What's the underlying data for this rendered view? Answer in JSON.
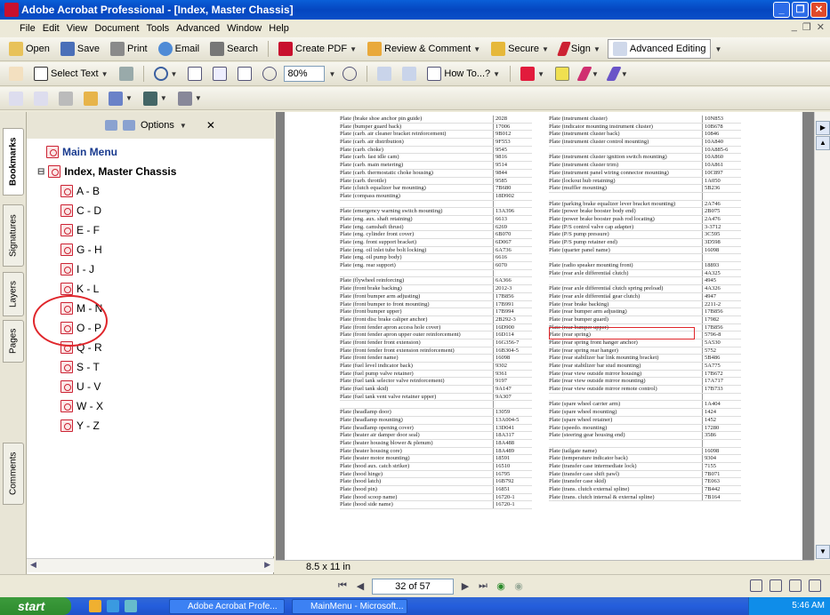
{
  "window": {
    "title": "Adobe Acrobat Professional - [Index, Master Chassis]",
    "controls": [
      "_",
      "❐",
      "✕"
    ]
  },
  "menu": [
    "File",
    "Edit",
    "View",
    "Document",
    "Tools",
    "Advanced",
    "Window",
    "Help"
  ],
  "mdi_controls": [
    "_",
    "❐",
    "✕"
  ],
  "toolbar1": {
    "open": "Open",
    "save": "Save",
    "print": "Print",
    "email": "Email",
    "search": "Search",
    "create_pdf": "Create PDF",
    "review": "Review & Comment",
    "secure": "Secure",
    "sign": "Sign",
    "advanced_editing": "Advanced Editing"
  },
  "toolbar2": {
    "select_text": "Select Text",
    "zoom": "80%",
    "howto": "How To...?"
  },
  "panel": {
    "options": "Options",
    "close": "✕",
    "tabs": [
      "Bookmarks",
      "Signatures",
      "Layers",
      "Pages",
      "Comments"
    ],
    "bookmarks": [
      "Main Menu",
      "Index, Master Chassis",
      "A - B",
      "C - D",
      "E - F",
      "G - H",
      "I - J",
      "K - L",
      "M - N",
      "O - P",
      "Q - R",
      "S - T",
      "U - V",
      "W - X",
      "Y - Z"
    ]
  },
  "document": {
    "left_column": [
      [
        "Plate (brake shoe anchor pin guide)",
        "2028"
      ],
      [
        "Plate (bumper guard back)",
        "17006"
      ],
      [
        "Plate (carb. air cleaner bracket reinforcement)",
        "9B012"
      ],
      [
        "Plate (carb. air distribution)",
        "9F553"
      ],
      [
        "Plate (carb. choke)",
        "9545"
      ],
      [
        "Plate (carb. fast idle cam)",
        "9816"
      ],
      [
        "Plate (carb. main metering)",
        "9514"
      ],
      [
        "Plate (carb. thermostatic choke housing)",
        "9844"
      ],
      [
        "Plate (carb. throttle)",
        "9585"
      ],
      [
        "Plate (clutch equalizer bar mounting)",
        "7B680"
      ],
      [
        "Plate (compass mounting)",
        "18D902"
      ],
      [
        "",
        ""
      ],
      [
        "Plate (emergency warning switch mounting)",
        "13A396"
      ],
      [
        "Plate (eng. aux. shaft retaining)",
        "6613"
      ],
      [
        "Plate (eng. camshaft thrust)",
        "6269"
      ],
      [
        "Plate (eng. cylinder front cover)",
        "6B070"
      ],
      [
        "Plate (eng. front support bracket)",
        "6D067"
      ],
      [
        "Plate (eng. oil inlet tube bolt locking)",
        "6A736"
      ],
      [
        "Plate (eng. oil pump body)",
        "6616"
      ],
      [
        "Plate (eng. rear support)",
        "6070"
      ],
      [
        "",
        ""
      ],
      [
        "Plate (flywheel reinforcing)",
        "6A366"
      ],
      [
        "Plate (front brake backing)",
        "2012-3"
      ],
      [
        "Plate (front bumper arm adjusting)",
        "17B856"
      ],
      [
        "Plate (front bumper to front mounting)",
        "17B991"
      ],
      [
        "Plate (front bumper upper)",
        "17B994"
      ],
      [
        "Plate (front disc brake caliper anchor)",
        "2B292-3"
      ],
      [
        "Plate (front fender apron access hole cover)",
        "16D900"
      ],
      [
        "Plate (front fender apron upper outer reinforcement)",
        "16D114"
      ],
      [
        "Plate (front fender front extension)",
        "16G356-7"
      ],
      [
        "Plate (front fender front extension reinforcement)",
        "16B304-5"
      ],
      [
        "Plate (front fender name)",
        "16098"
      ],
      [
        "Plate (fuel level indicator back)",
        "9302"
      ],
      [
        "Plate (fuel pump valve retainer)",
        "9361"
      ],
      [
        "Plate (fuel tank selector valve reinforcement)",
        "9197"
      ],
      [
        "Plate (fuel tank skid)",
        "9A147"
      ],
      [
        "Plate (fuel tank vent valve retainer upper)",
        "9A307"
      ],
      [
        "",
        ""
      ],
      [
        "Plate (headlamp door)",
        "13059"
      ],
      [
        "Plate (headlamp mounting)",
        "13A004-5"
      ],
      [
        "Plate (headlamp opening cover)",
        "13D041"
      ],
      [
        "Plate (heater air damper door seal)",
        "18A317"
      ],
      [
        "Plate (heater housing blower & plenum)",
        "18A488"
      ],
      [
        "Plate (heater housing core)",
        "18A489"
      ],
      [
        "Plate (heater motor mounting)",
        "18591"
      ],
      [
        "Plate (hood aux. catch striker)",
        "16510"
      ],
      [
        "Plate (hood hinge)",
        "16795"
      ],
      [
        "Plate (hood latch)",
        "16B792"
      ],
      [
        "Plate (hood pin)",
        "16851"
      ],
      [
        "Plate (hood scoop name)",
        "16720-1"
      ],
      [
        "Plate (hood side name)",
        "16720-1"
      ]
    ],
    "right_column": [
      [
        "Plate (instrument cluster)",
        "10N853"
      ],
      [
        "Plate (indicator mounting instrument cluster)",
        "10B678"
      ],
      [
        "Plate (instrument cluster back)",
        "10846"
      ],
      [
        "Plate (instrument cluster control mounting)",
        "10A840"
      ],
      [
        "",
        "10A885-6"
      ],
      [
        "Plate (instrument cluster ignition switch mounting)",
        "10A860"
      ],
      [
        "Plate (instrument cluster trim)",
        "10A861"
      ],
      [
        "Plate (instrument panel wiring connector mounting)",
        "10C897"
      ],
      [
        "Plate (lockout hub retaining)",
        "1A050"
      ],
      [
        "Plate (muffler mounting)",
        "5B236"
      ],
      [
        "",
        ""
      ],
      [
        "Plate (parking brake equalizer lever bracket mounting)",
        "2A746"
      ],
      [
        "Plate (power brake booster body end)",
        "2B075"
      ],
      [
        "Plate (power brake booster push rod locating)",
        "2A476"
      ],
      [
        "Plate (P/S control valve cap adapter)",
        "3-3712"
      ],
      [
        "Plate (P/S pump pressure)",
        "3C595"
      ],
      [
        "Plate (P/S pump retainer end)",
        "3D598"
      ],
      [
        "Plate (quarter panel name)",
        "16098"
      ],
      [
        "",
        ""
      ],
      [
        "Plate (radio speaker mounting front)",
        "18893"
      ],
      [
        "Plate (rear axle differential clutch)",
        "4A325"
      ],
      [
        "",
        "4945"
      ],
      [
        "Plate (rear axle differential clutch spring preload)",
        "4A326"
      ],
      [
        "Plate (rear axle differential gear clutch)",
        "4947"
      ],
      [
        "Plate (rear brake backing)",
        "2211-2"
      ],
      [
        "Plate (rear bumper arm adjusting)",
        "17B856"
      ],
      [
        "Plate (rear bumper guard)",
        "17982"
      ],
      [
        "Plate (rear bumper upper)",
        "17B856"
      ],
      [
        "Plate (rear spring)",
        "5796-8"
      ],
      [
        "Plate (rear spring front hanger anchor)",
        "5A530"
      ],
      [
        "Plate (rear spring rear hanger)",
        "5752"
      ],
      [
        "Plate (rear stabilizer bar link mounting bracket)",
        "5B486"
      ],
      [
        "Plate (rear stabilizer bar stud mounting)",
        "5A775"
      ],
      [
        "Plate (rear view outside mirror housing)",
        "17B672"
      ],
      [
        "Plate (rear view outside mirror mounting)",
        "17A717"
      ],
      [
        "Plate (rear view outside mirror remote control)",
        "17B733"
      ],
      [
        "",
        ""
      ],
      [
        "Plate (spare wheel carrier arm)",
        "1A404"
      ],
      [
        "Plate (spare wheel mounting)",
        "1424"
      ],
      [
        "Plate (spare wheel retainer)",
        "1452"
      ],
      [
        "Plate (speedo. mounting)",
        "17280"
      ],
      [
        "Plate (steering gear housing end)",
        "3586"
      ],
      [
        "",
        ""
      ],
      [
        "Plate (tailgate name)",
        "16098"
      ],
      [
        "Plate (temperature indicator back)",
        "9304"
      ],
      [
        "Plate (transfer case intermediate lock)",
        "7155"
      ],
      [
        "Plate (transfer case shift pawl)",
        "7B071"
      ],
      [
        "Plate (transfer case skid)",
        "7E063"
      ],
      [
        "Plate (trans. clutch external spline)",
        "7B442"
      ],
      [
        "Plate (trans. clutch internal & external spline)",
        "7B164"
      ]
    ]
  },
  "statusbar": {
    "page_size": "8.5 x 11 in",
    "page_indicator": "32 of 57"
  },
  "taskbar": {
    "start": "start",
    "tasks": [
      "Adobe Acrobat Profe...",
      "MainMenu - Microsoft..."
    ],
    "clock": "5:46 AM"
  }
}
